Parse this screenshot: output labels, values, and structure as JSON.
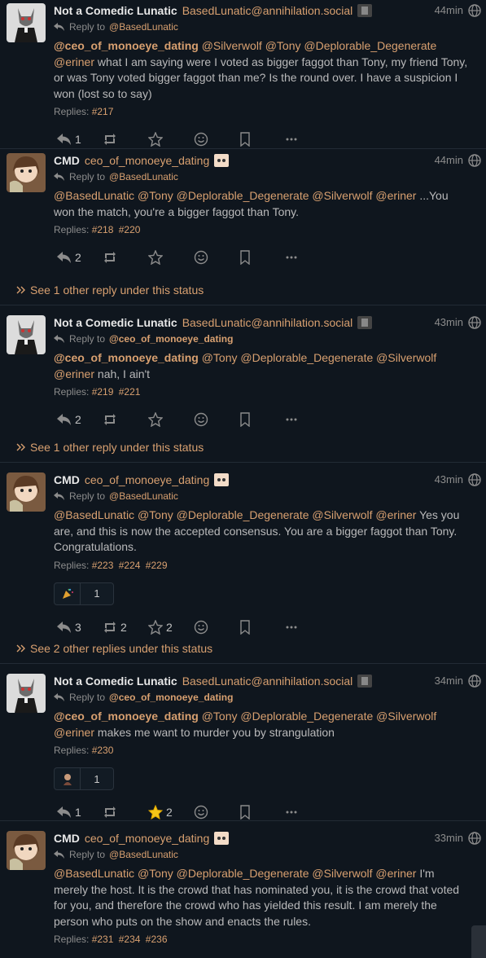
{
  "posts": [
    {
      "name": "Not a Comedic Lunatic",
      "handle": "BasedLunatic@annihilation.social",
      "time": "44min",
      "reply_prefix": "Reply to",
      "reply_to": "@BasedLunatic",
      "mentions": [
        "@ceo_of_monoeye_dating",
        "@Deplorable_Degenerate",
        "@Silverwolf",
        "@Tony",
        "@eriner"
      ],
      "text_after": "what I am saying were I voted as bigger faggot than Tony, my friend Tony, or was Tony voted bigger faggot than me? Is the round over. I have a suspicion I won (lost so to say)",
      "replies_label": "Replies:",
      "replies": [
        "#217"
      ],
      "reply_count": "1",
      "repeat_count": "",
      "fav_count": ""
    },
    {
      "name": "CMD",
      "handle": "ceo_of_monoeye_dating",
      "time": "44min",
      "reply_prefix": "Reply to",
      "reply_to": "@BasedLunatic",
      "mentions": [
        "@BasedLunatic",
        "@Tony",
        "@Deplorable_Degenerate",
        "@Silverwolf",
        "@eriner"
      ],
      "text_after": "...You won the match, you're a bigger faggot than Tony.",
      "replies_label": "Replies:",
      "replies": [
        "#218",
        "#220"
      ],
      "reply_count": "2",
      "repeat_count": "",
      "fav_count": ""
    },
    {
      "name": "Not a Comedic Lunatic",
      "handle": "BasedLunatic@annihilation.social",
      "time": "43min",
      "reply_prefix": "Reply to",
      "reply_to": "@ceo_of_monoeye_dating",
      "mentions": [
        "@ceo_of_monoeye_dating",
        "@Tony",
        "@Deplorable_Degenerate",
        "@Silverwolf",
        "@eriner"
      ],
      "text_after": "nah, I ain't",
      "replies_label": "Replies:",
      "replies": [
        "#219",
        "#221"
      ],
      "reply_count": "2",
      "repeat_count": "",
      "fav_count": ""
    },
    {
      "name": "CMD",
      "handle": "ceo_of_monoeye_dating",
      "time": "43min",
      "reply_prefix": "Reply to",
      "reply_to": "@BasedLunatic",
      "mentions": [
        "@BasedLunatic",
        "@Tony",
        "@Deplorable_Degenerate",
        "@Silverwolf",
        "@eriner"
      ],
      "text_after": "Yes you are, and this is now the accepted consensus. You are a bigger faggot than Tony. Congratulations.",
      "replies_label": "Replies:",
      "replies": [
        "#223",
        "#224",
        "#229"
      ],
      "reaction_count": "1",
      "reply_count": "3",
      "repeat_count": "2",
      "fav_count": "2"
    },
    {
      "name": "Not a Comedic Lunatic",
      "handle": "BasedLunatic@annihilation.social",
      "time": "34min",
      "reply_prefix": "Reply to",
      "reply_to": "@ceo_of_monoeye_dating",
      "mentions": [
        "@ceo_of_monoeye_dating",
        "@Tony",
        "@Deplorable_Degenerate",
        "@Silverwolf",
        "@eriner"
      ],
      "text_after": "makes me want to murder you by strangulation",
      "replies_label": "Replies:",
      "replies": [
        "#230"
      ],
      "reaction_count": "1",
      "reply_count": "1",
      "repeat_count": "",
      "fav_count": "2"
    },
    {
      "name": "CMD",
      "handle": "ceo_of_monoeye_dating",
      "time": "33min",
      "reply_prefix": "Reply to",
      "reply_to": "@BasedLunatic",
      "mentions": [
        "@BasedLunatic",
        "@Tony",
        "@Deplorable_Degenerate",
        "@Silverwolf",
        "@eriner"
      ],
      "text_after": "I'm merely the host. It is the crowd that has nominated you, it is the crowd that voted for you, and therefore the crowd who has yielded this result. I am merely the person who puts on the show and enacts the rules.",
      "replies_label": "Replies:",
      "replies": [
        "#231",
        "#234",
        "#236"
      ]
    }
  ],
  "see_other": [
    "See 1 other reply under this status",
    "See 1 other reply under this status",
    "See 2 other replies under this status"
  ],
  "colors": {
    "accent": "#d8a070",
    "bg": "#0f161e",
    "text": "#b9b9ba",
    "muted": "#8c8c8c"
  }
}
